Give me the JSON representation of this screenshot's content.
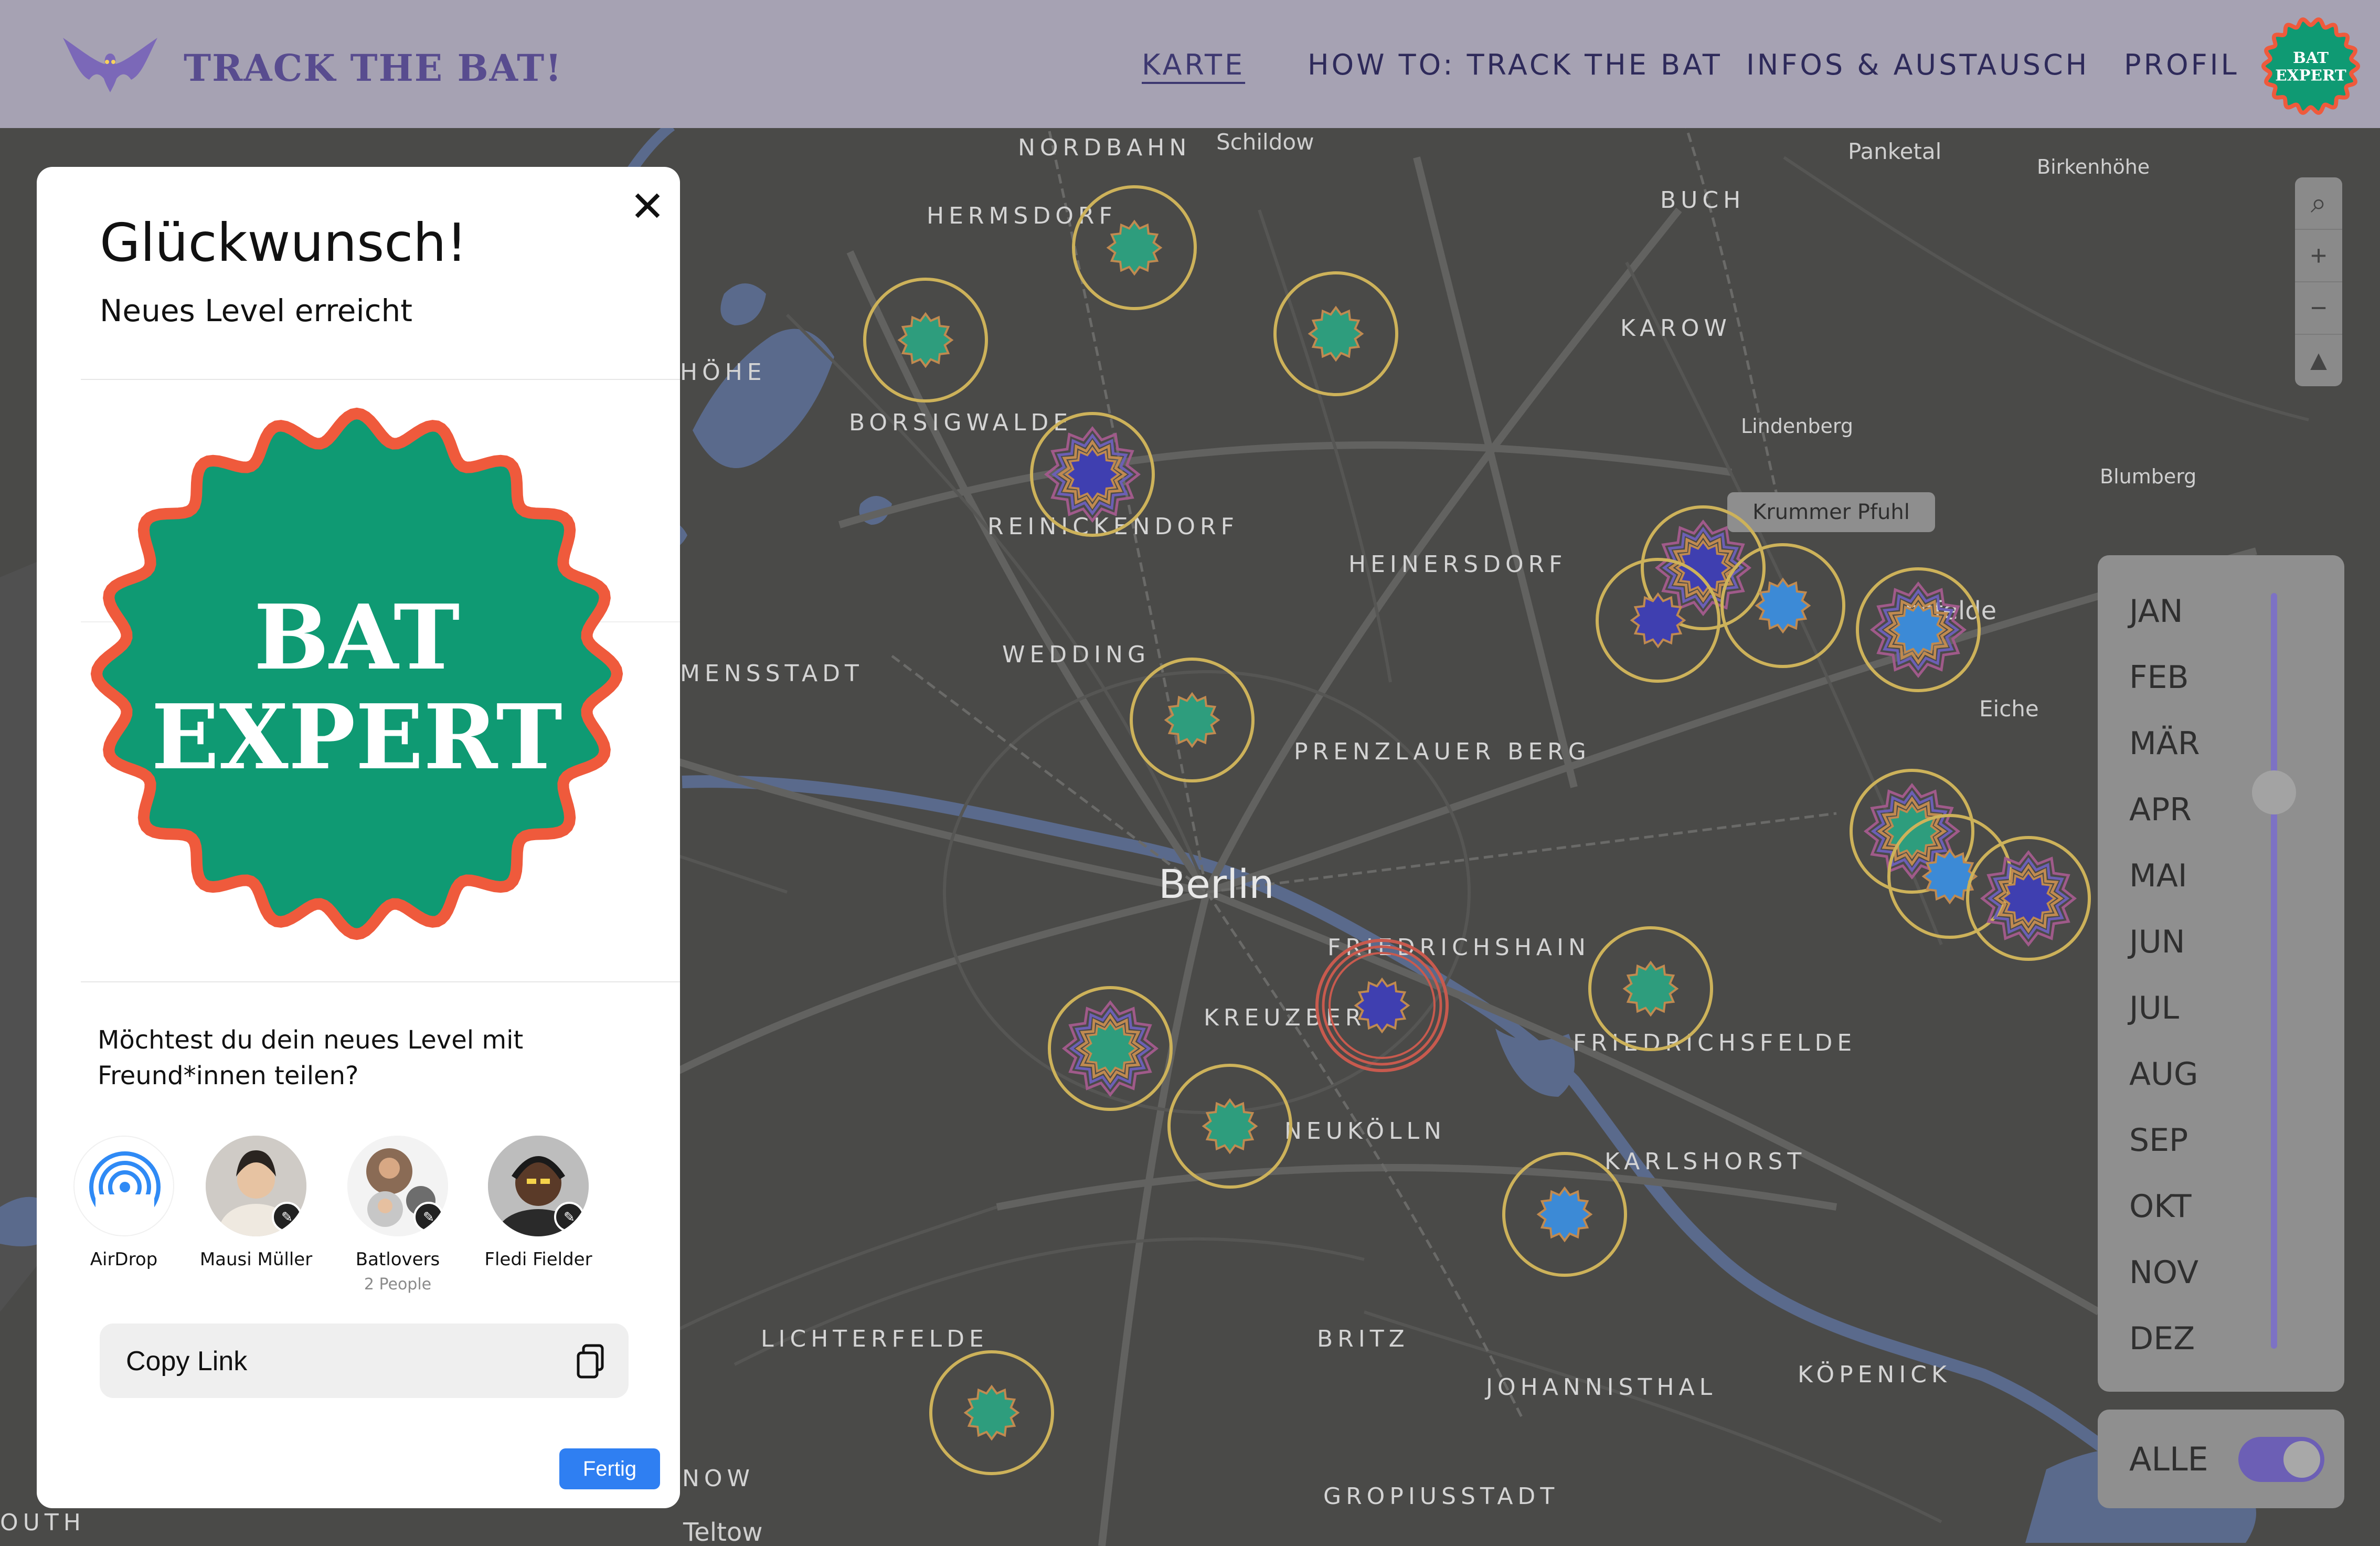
{
  "header": {
    "logo_text": "TRACK THE BAT!",
    "nav": [
      {
        "label": "KARTE",
        "active": true
      },
      {
        "label": "HOW TO: TRACK THE BAT",
        "active": false
      },
      {
        "label": "INFOS & AUSTAUSCH",
        "active": false
      },
      {
        "label": "PROFIL",
        "active": false
      }
    ],
    "profile_badge": [
      "BAT",
      "EXPERT"
    ]
  },
  "map": {
    "city": "Berlin",
    "districts": [
      "NORDBAHN",
      "HERMSDORF",
      "BUCH",
      "KAROW",
      "BORSIGWALDE",
      "REINICKENDORF",
      "HEINERSDORF",
      "WEDDING",
      "PRENZLAUER BERG",
      "FRIEDRICHSHAIN",
      "KREUZBERG",
      "FRIEDRICHSFELDE",
      "NEUKÖLLN",
      "KARLSHORST",
      "LICHTERFELDE",
      "BRITZ",
      "JOHANNISTHAL",
      "KÖPENICK",
      "GROPIUSSTADT",
      "HÖHE",
      "MENSSTADT",
      "NOW",
      "OUTH"
    ],
    "places": [
      "Schildow",
      "Panketal",
      "Birkenhöhe",
      "Lindenberg",
      "Blumberg",
      "Eiche",
      "Teltow",
      "nsfelde"
    ],
    "tooltip": "Krummer Pfuhl",
    "controls": [
      "search-icon",
      "zoom-in",
      "zoom-out",
      "north-arrow"
    ],
    "controls_glyphs": [
      "⌕",
      "+",
      "−",
      "▲"
    ]
  },
  "months": [
    "JAN",
    "FEB",
    "MÄR",
    "APR",
    "MAI",
    "JUN",
    "JUL",
    "AUG",
    "SEP",
    "OKT",
    "NOV",
    "DEZ"
  ],
  "filter": {
    "label": "ALLE",
    "enabled": true
  },
  "colors": {
    "header": "#a6a2b3",
    "map": "#4a4a48",
    "accent_purple": "#6c5fb5",
    "badge_green": "#0f9a73",
    "badge_red": "#ef5a3c",
    "primary_blue": "#2f7ff2"
  },
  "modal": {
    "close_glyph": "✕",
    "title": "Glückwunsch!",
    "subtitle": "Neues Level erreicht",
    "badge_lines": [
      "BAT",
      "EXPERT"
    ],
    "share_question": "Möchtest du dein neues Level mit Freund*innen teilen?",
    "contacts": [
      {
        "name": "AirDrop",
        "meta": ""
      },
      {
        "name": "Mausi Müller",
        "meta": ""
      },
      {
        "name": "Batlovers",
        "meta": "2 People"
      },
      {
        "name": "Fledi Fielder",
        "meta": ""
      }
    ],
    "copy_link": "Copy Link",
    "done": "Fertig"
  }
}
